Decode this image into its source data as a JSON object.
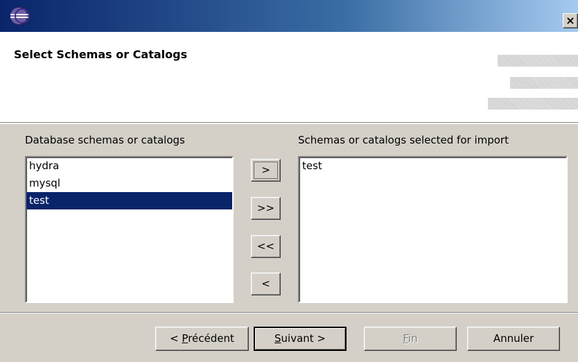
{
  "window": {
    "title": "",
    "close_label": "×",
    "app_icon": "eclipse-icon"
  },
  "header": {
    "title": "Select Schemas or Catalogs"
  },
  "left_panel": {
    "label": "Database schemas or catalogs",
    "items": [
      "hydra",
      "mysql",
      "test"
    ],
    "selected": "test"
  },
  "right_panel": {
    "label": "Schemas or catalogs selected for import",
    "items": [
      "test"
    ]
  },
  "move_buttons": {
    "add": ">",
    "add_all": ">>",
    "remove_all": "<<",
    "remove": "<"
  },
  "nav": {
    "back_prefix": "< ",
    "back_mnemonic": "P",
    "back_rest": "récédent",
    "next_mnemonic": "S",
    "next_rest": "uivant >",
    "finish_mnemonic": "F",
    "finish_rest": "in",
    "cancel": "Annuler"
  },
  "colors": {
    "selection": "#0a246a",
    "titlebar_start": "#0a246a",
    "titlebar_end": "#a6caf0"
  }
}
